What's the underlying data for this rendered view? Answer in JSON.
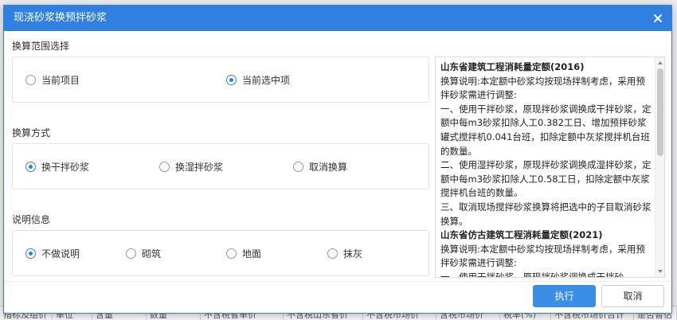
{
  "background_tabs": [
    "指标及组价",
    "单位",
    "含量",
    "数量",
    "不含税省单价",
    "不含税山东省价",
    "不含税市场价",
    "含税市场价",
    "税率(%)",
    "不含税市场价合计",
    "是否暂估"
  ],
  "dialog": {
    "title": "现浇砂浆换预拌砂浆",
    "close_icon": "close-icon"
  },
  "range": {
    "label": "换算范围选择",
    "options": [
      "当前项目",
      "当前选中项"
    ],
    "selected": 1
  },
  "method": {
    "label": "换算方式",
    "options": [
      "换干拌砂浆",
      "换湿拌砂浆",
      "取消换算"
    ],
    "selected": 0
  },
  "note": {
    "label": "说明信息",
    "options": [
      "不做说明",
      "砌筑",
      "地面",
      "抹灰"
    ],
    "selected": 0
  },
  "description": [
    {
      "text": "山东省建筑工程消耗量定额(2016)",
      "bold": true
    },
    {
      "text": "换算说明:本定额中砂浆均按现场拌制考虑，采用预拌砂浆需进行调整:",
      "bold": false
    },
    {
      "text": "一、使用干拌砂浆，原现拌砂浆调换成干拌砂浆，定额中每m3砂浆扣除人工0.382工日、增加预拌砂浆罐式搅拌机0.041台班，扣除定额中灰浆搅拌机台班的数量。",
      "bold": false
    },
    {
      "text": "二、使用湿拌砂浆，原现拌砂浆调换成湿拌砂浆，定额中每m3砂浆扣除人工0.58工日，扣除定额中灰浆搅拌机台班的数量。",
      "bold": false
    },
    {
      "text": "三、取消现场搅拌砂浆换算将把选中的子目取消砂浆换算。",
      "bold": false
    },
    {
      "text": "山东省仿古建筑工程消耗量定额(2021)",
      "bold": true
    },
    {
      "text": "换算说明:本定额中砂浆均按现场拌制考虑，采用预拌砂浆需进行调整:",
      "bold": false
    },
    {
      "text": "一、使用干拌砂浆，原现拌砂浆调换成干拌砂",
      "bold": false
    }
  ],
  "buttons": {
    "execute": "执行",
    "cancel": "取消"
  },
  "colors": {
    "accent": "#2f80e0",
    "primary_button": "#3a8ee6"
  }
}
